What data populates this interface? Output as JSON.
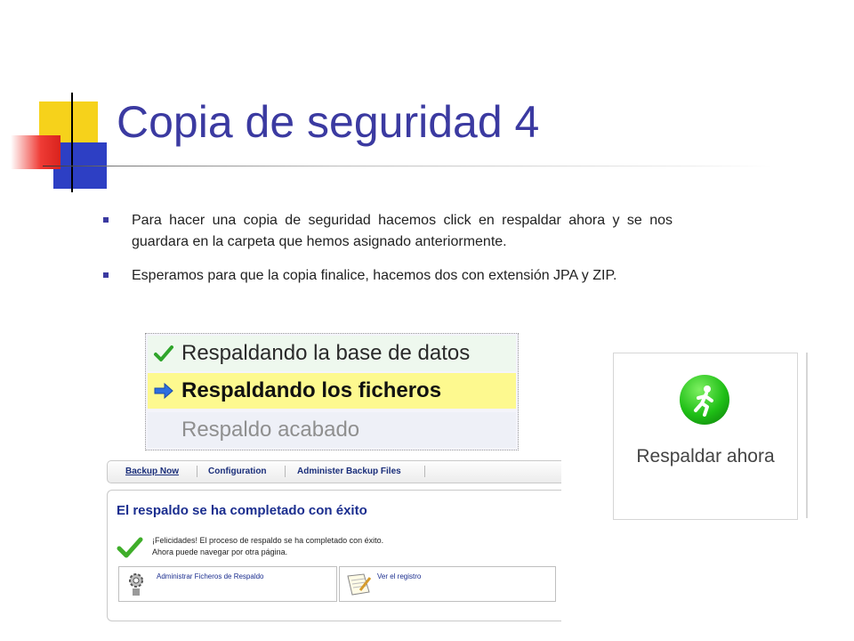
{
  "slide": {
    "title": "Copia de seguridad 4",
    "bullets": [
      "Para hacer una copia de seguridad hacemos click en respaldar ahora y se nos guardara en la carpeta que hemos asignado anteriormente.",
      "Esperamos para que la copia finalice, hacemos dos con extensión JPA y ZIP."
    ]
  },
  "status_panel": {
    "rows": [
      {
        "label": "Respaldando la base de datos",
        "state": "done"
      },
      {
        "label": "Respaldando los ficheros",
        "state": "in-progress"
      },
      {
        "label": "Respaldo acabado",
        "state": "pending"
      }
    ]
  },
  "backup_button": {
    "label": "Respaldar ahora",
    "icon": "runner-icon"
  },
  "backup_admin": {
    "tabs": [
      "Backup Now",
      "Configuration",
      "Administer Backup Files"
    ],
    "title": "El respaldo se ha completado con éxito",
    "message_line1": "¡Felicidades! El proceso de respaldo se ha completado con éxito.",
    "message_line2": "Ahora puede navegar por otra página.",
    "links": [
      {
        "label": "Administrar Ficheros de Respaldo",
        "icon": "gear-icon"
      },
      {
        "label": "Ver el registro",
        "icon": "notepad-icon"
      }
    ]
  },
  "colors": {
    "title": "#3b3aa1",
    "highlight": "#fdf98f",
    "panel_title": "#1b2e8f",
    "accent_green": "#1fbf16"
  }
}
